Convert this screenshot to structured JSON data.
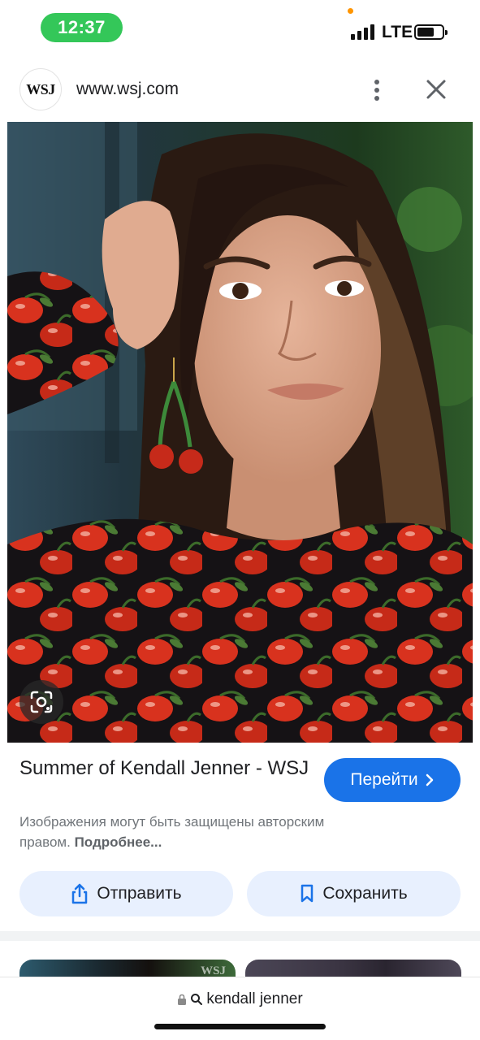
{
  "status_bar": {
    "time": "12:37",
    "network": "LTE",
    "colors": {
      "time_pill": "#34c759",
      "privacy_dot": "#ff9500"
    }
  },
  "header": {
    "logo_text": "WSJ",
    "url": "www.wsj.com",
    "icons": {
      "menu": "more-vert-icon",
      "close": "close-icon"
    }
  },
  "image": {
    "description_icon": "lens-icon"
  },
  "result": {
    "title": "Summer of Kendall Jenner - WSJ",
    "go_button_label": "Перейти",
    "copyright_text": "Изображения могут быть защищены авторским правом.",
    "more_link": "Подробнее..."
  },
  "actions": {
    "share_label": "Отправить",
    "save_label": "Сохранить",
    "accent_color": "#1a73e8",
    "button_bg": "#e8f0fe"
  },
  "related": {
    "thumb_1_watermark": "WSJ"
  },
  "bottom_bar": {
    "query": "kendall jenner"
  }
}
